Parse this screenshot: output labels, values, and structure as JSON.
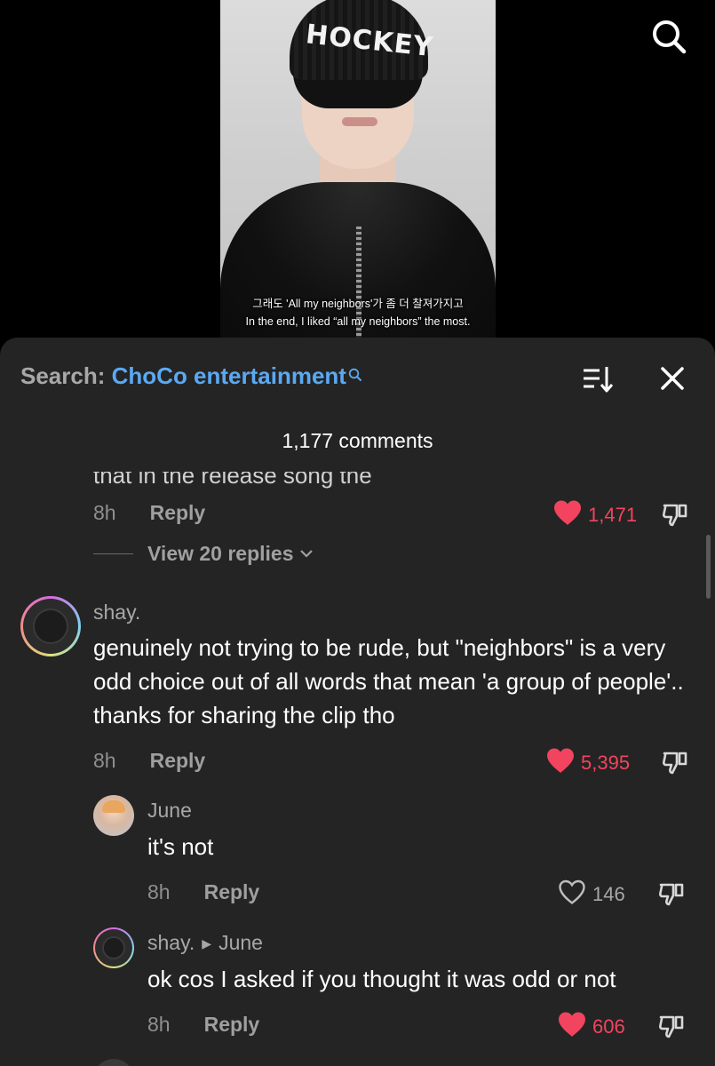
{
  "video": {
    "beanie_text": "HOCKEY",
    "subtitle_ko": "그래도 'All my neighbors'가 좀 더 찰져가지고",
    "subtitle_en": "In the end, I liked “all my neighbors” the most."
  },
  "panel": {
    "search_label": "Search:",
    "search_query": "ChoCo entertainment",
    "comment_count": "1,177 comments",
    "cut_off_text": "that in the release song the"
  },
  "comments": [
    {
      "time": "8h",
      "reply_label": "Reply",
      "likes": "1,471",
      "liked": true,
      "view_replies": "View 20 replies"
    },
    {
      "username": "shay.",
      "text": "genuinely not trying to be rude, but \"neighbors\" is a very odd choice out of all words that mean 'a group of people'.. thanks for sharing the clip tho",
      "time": "8h",
      "reply_label": "Reply",
      "likes": "5,395",
      "liked": true
    },
    {
      "username": "June",
      "text": "it's not",
      "time": "8h",
      "reply_label": "Reply",
      "likes": "146",
      "liked": false
    },
    {
      "username": "shay.",
      "reply_to": "June",
      "text": "ok cos I asked if you thought it was odd or not",
      "time": "8h",
      "reply_label": "Reply",
      "likes": "606",
      "liked": true
    }
  ],
  "colors": {
    "panel_bg": "#242424",
    "accent_blue": "#5aa9f2",
    "like_red": "#f2445e"
  },
  "icons": [
    "search-icon",
    "sort-icon",
    "close-icon",
    "heart-icon",
    "heart-outline-icon",
    "dislike-icon",
    "chevron-down-icon"
  ]
}
